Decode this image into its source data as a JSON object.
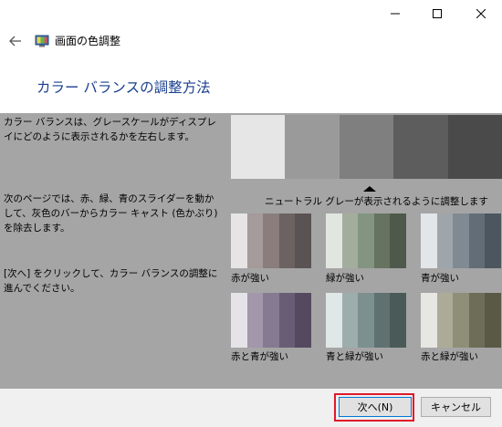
{
  "window": {
    "title": "画面の色調整",
    "controls": [
      "minimize-icon",
      "maximize-icon",
      "close-icon"
    ]
  },
  "page": {
    "heading": "カラー バランスの調整方法",
    "paragraphs": [
      "カラー バランスは、グレースケールがディスプレイにどのように表示されるかを左右します。",
      "次のページでは、赤、緑、青のスライダーを動かして、灰色のバーからカラー キャスト (色かぶり) を除去します。",
      "[次へ] をクリックして、カラー バランスの調整に進んでください。"
    ],
    "neutral_label": "ニュートラル グレーが表示されるように調整します",
    "gray_strip": [
      "#e6e6e6",
      "#9a9a9a",
      "#7f7f7f",
      "#5d5d5d",
      "#4a4a4a"
    ]
  },
  "swatches": [
    {
      "label": "赤が強い",
      "colors": [
        "#e6e4e4",
        "#a59b9a",
        "#8a7d7c",
        "#6c6262",
        "#5a5353"
      ]
    },
    {
      "label": "緑が強い",
      "colors": [
        "#e2e6e0",
        "#a3ad9e",
        "#839581",
        "#66735f",
        "#4f594b"
      ]
    },
    {
      "label": "青が強い",
      "colors": [
        "#e3e6e8",
        "#9ea6ac",
        "#7f8a93",
        "#626d77",
        "#4c565f"
      ]
    },
    {
      "label": "赤と青が強い",
      "colors": [
        "#e6e3e8",
        "#a297ab",
        "#867a92",
        "#685d74",
        "#55495f"
      ]
    },
    {
      "label": "青と緑が強い",
      "colors": [
        "#e0e7e7",
        "#9dadac",
        "#7b908f",
        "#5f7271",
        "#4a5a59"
      ]
    },
    {
      "label": "赤と緑が強い",
      "colors": [
        "#e6e6e2",
        "#acab98",
        "#8f8e77",
        "#6e6d58",
        "#5a5946"
      ]
    }
  ],
  "footer": {
    "next_label": "次へ(N)",
    "cancel_label": "キャンセル"
  },
  "colors": {
    "heading": "#1a3f8f",
    "content_bg": "#a5a5a5",
    "highlight": "#e0192a",
    "button_focus": "#0078d7"
  }
}
